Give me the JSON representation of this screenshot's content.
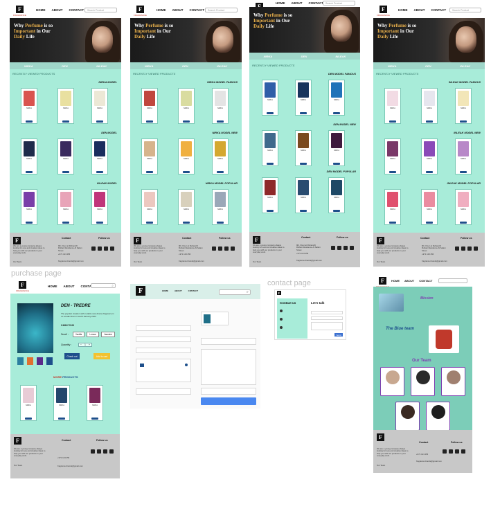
{
  "labels": {
    "purchase_page": "purchase page",
    "contact_page": "contact page"
  },
  "nav": {
    "brand": "FRAGRANCE",
    "home": "HOME",
    "about": "ABOUT",
    "contact": "CONTACT",
    "search_placeholder": "Search Product"
  },
  "hero": {
    "line1_a": "Why ",
    "line1_b": "Perfume",
    "line1_c": " is so",
    "line2_a": "Important",
    "line2_b": " in Our",
    "line3_a": "Daily",
    "line3_b": " Life"
  },
  "brands": [
    "NIRKA",
    "DEN",
    "INLEAK"
  ],
  "recent": "RECENTLY VIEWED PRODUCTS",
  "sections": {
    "f1": [
      "NIRKA MODEL",
      "DEN MODEL",
      "INLEAK MODEL"
    ],
    "f2": [
      "NIRKA MODEL FAMOUS",
      "NIRKA MODEL NEW",
      "NIRKA MODEL POPULAR"
    ],
    "f3": [
      "DEN MODEL FAMOUS",
      "DEN MODEL NEW",
      "DEN MODEL POPULAR"
    ],
    "f4": [
      "INLEAK MODEL FAMOUS",
      "INLEAK MODEL NEW",
      "INLEAK MODEL POPULAR"
    ]
  },
  "card_label": "NIRKA",
  "footer": {
    "contact": "Contact",
    "follow": "Follow us",
    "about_text": "We are a young company always looking for new and creative ideas to help you with our products in your everyday work.",
    "team": "Our Team",
    "address": "9th, Floor at Ruhani/Al Ruhani Residence Al Salam Street",
    "phone": "+971 123 456",
    "email": "fragrance.brands@gmail.com"
  },
  "purchase": {
    "title": "DEN - TREDRE",
    "desc": "The popular creation with notable new drama fragrance in no smaller than in world January 2024",
    "price": "CASH 70.00",
    "smell_label": "Smell :",
    "smells": [
      "Vanilla",
      "Lemon",
      "Jasmine"
    ],
    "quantity_label": "Quantity :",
    "qty": "1",
    "checkout": "Check out",
    "add_cart": "Add to cart",
    "more_a": "MORE",
    "more_b": " PRODUCTS"
  },
  "contact": {
    "contact_us": "Contact us",
    "lets_talk": "Let's talk",
    "send": "Send"
  },
  "about": {
    "mission": "Mission",
    "blue_team": "The Blue team",
    "our_team": "Our Team"
  },
  "colors": {
    "mint": "#a8ecd9",
    "teal_band": "#9fd6c9",
    "gold": "#e8b04c",
    "navy": "#1d4f8b",
    "footer": "#c8c8c8"
  }
}
